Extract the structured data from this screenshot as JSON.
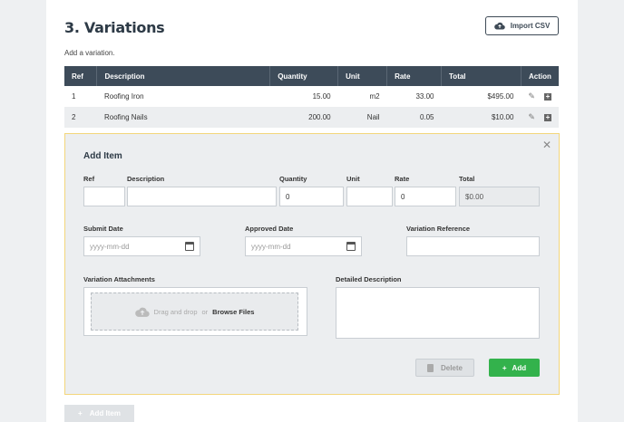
{
  "section": {
    "title": "3. Variations",
    "subtitle": "Add a variation.",
    "import_label": "Import CSV"
  },
  "table": {
    "headers": [
      "Ref",
      "Description",
      "Quantity",
      "Unit",
      "Rate",
      "Total",
      "Action"
    ],
    "rows": [
      [
        "1",
        "Roofing Iron",
        "15.00",
        "m2",
        "33.00",
        "$495.00"
      ],
      [
        "2",
        "Roofing Nails",
        "200.00",
        "Nail",
        "0.05",
        "$10.00"
      ]
    ]
  },
  "add_item": {
    "title": "Add Item",
    "labels": {
      "ref": "Ref",
      "description": "Description",
      "quantity": "Quantity",
      "unit": "Unit",
      "rate": "Rate",
      "total": "Total",
      "submit_date": "Submit Date",
      "approved_date": "Approved Date",
      "variation_reference": "Variation Reference",
      "variation_attachments": "Variation Attachments",
      "detailed_description": "Detailed Description"
    },
    "values": {
      "ref": "",
      "description": "",
      "quantity": "0",
      "unit": "",
      "rate": "0",
      "total": "$0.00",
      "variation_reference": ""
    },
    "placeholders": {
      "submit_date": "yyyy-mm-dd",
      "approved_date": "yyyy-mm-dd"
    },
    "dropzone": {
      "text": "Drag and drop",
      "or": "or",
      "browse": "Browse Files"
    },
    "delete_label": "Delete",
    "add_label": "Add"
  },
  "footer": {
    "add_item_label": "Add Item"
  },
  "colors": {
    "header_bg": "#3d4b59",
    "add_green": "#33b24c",
    "panel_border": "#f3d67b"
  }
}
